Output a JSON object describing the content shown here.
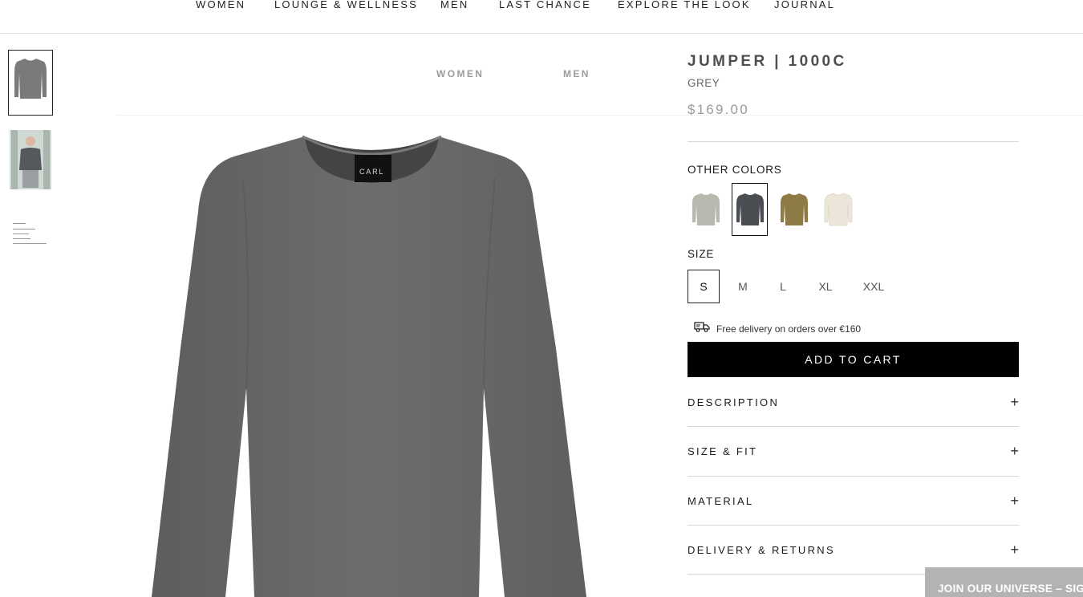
{
  "top_nav": {
    "items": [
      "WOMEN",
      "LOUNGE & WELLNESS",
      "MEN",
      "LAST CHANCE",
      "EXPLORE THE LOOK",
      "JOURNAL"
    ]
  },
  "overlay_nav": {
    "items": [
      "WOMEN",
      "MEN"
    ]
  },
  "gallery": {
    "brand_label": "CARL"
  },
  "product": {
    "title": "JUMPER | 1000C",
    "color": "GREY",
    "price": "$169.00"
  },
  "other_colors": {
    "label": "OTHER COLORS",
    "swatches": [
      {
        "name": "light-grey",
        "hex": "#b8b8ae"
      },
      {
        "name": "dark-grey",
        "hex": "#4a4d52"
      },
      {
        "name": "olive",
        "hex": "#8e7a45"
      },
      {
        "name": "cream",
        "hex": "#ece6da"
      }
    ]
  },
  "size": {
    "label": "SIZE",
    "options": [
      "S",
      "M",
      "L",
      "XL",
      "XXL"
    ],
    "selected": "S"
  },
  "delivery": {
    "text": "Free delivery on orders over €160"
  },
  "cart": {
    "button_label": "ADD TO CART"
  },
  "accordion": {
    "sections": [
      "DESCRIPTION",
      "SIZE & FIT",
      "MATERIAL",
      "DELIVERY & RETURNS"
    ],
    "expand_symbol": "+"
  },
  "newsletter": {
    "text": "JOIN OUR UNIVERSE – SIG"
  },
  "colors": {
    "accent": "#000000",
    "jumper": "#6b6b6b"
  }
}
